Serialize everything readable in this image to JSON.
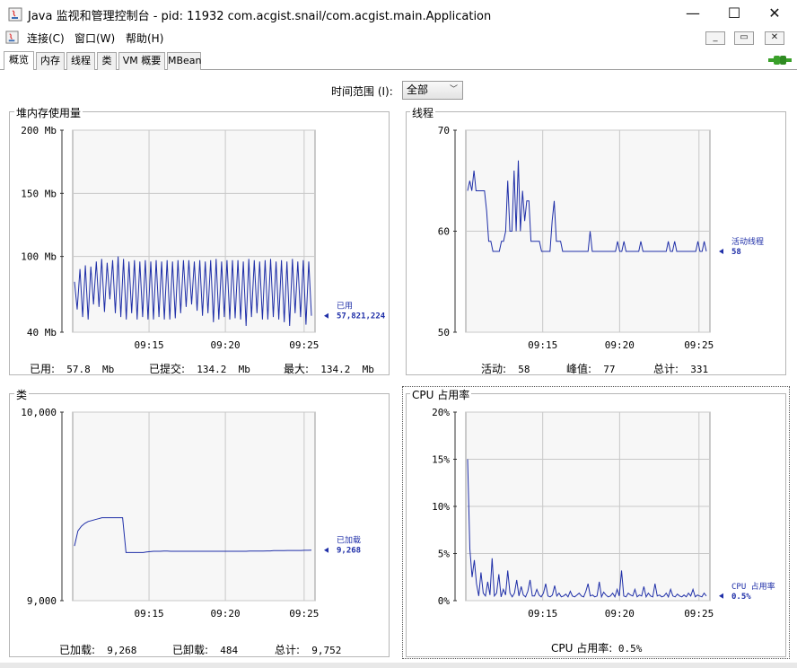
{
  "window": {
    "title": "Java 监视和管理控制台 - pid: 11932 com.acgist.snail/com.acgist.main.Application",
    "minimize": "—",
    "maximize": "☐",
    "close": "✕"
  },
  "menu": {
    "items": [
      "连接(C)",
      "窗口(W)",
      "帮助(H)"
    ]
  },
  "tabs": [
    "概览",
    "内存",
    "线程",
    "类",
    "VM 概要",
    "MBean"
  ],
  "time_range": {
    "label": "时间范围 (I):",
    "value": "全部"
  },
  "x_ticks": [
    "09:15",
    "09:20",
    "09:25"
  ],
  "chart_data": [
    {
      "type": "line",
      "title": "堆内存使用量",
      "y_ticks": [
        "200 Mb",
        "150 Mb",
        "100 Mb",
        "40 Mb"
      ],
      "ylim": [
        40,
        200
      ],
      "x_ticks": [
        "09:15",
        "09:20",
        "09:25"
      ],
      "series": [
        {
          "name": "已用",
          "last_value": "57,821,224",
          "values": [
            80,
            58,
            90,
            52,
            93,
            50,
            92,
            62,
            96,
            60,
            98,
            56,
            95,
            66,
            97,
            55,
            100,
            52,
            98,
            50,
            96,
            55,
            97,
            50,
            96,
            52,
            97,
            50,
            96,
            50,
            97,
            52,
            96,
            50,
            97,
            50,
            96,
            51,
            97,
            55,
            97,
            60,
            97,
            62,
            96,
            57,
            97,
            53,
            96,
            55,
            97,
            48,
            98,
            50,
            96,
            52,
            97,
            50,
            97,
            51,
            97,
            50,
            96,
            45,
            98,
            52,
            97,
            55,
            96,
            50,
            97,
            50,
            98,
            52,
            96,
            50,
            97,
            48,
            96,
            45,
            98,
            55,
            96,
            52,
            97,
            46,
            96,
            53
          ]
        }
      ],
      "footer": {
        "used_label": "已用:",
        "used": "57.8  Mb",
        "committed_label": "已提交:",
        "committed": "134.2  Mb",
        "max_label": "最大:",
        "max": "134.2  Mb"
      }
    },
    {
      "type": "line",
      "title": "线程",
      "y_ticks": [
        "70",
        "60",
        "50"
      ],
      "ylim": [
        50,
        70
      ],
      "x_ticks": [
        "09:15",
        "09:20",
        "09:25"
      ],
      "series": [
        {
          "name": "活动线程",
          "last_value": "58",
          "values": [
            64,
            65,
            64,
            66,
            64,
            64,
            64,
            64,
            64,
            62,
            59,
            59,
            58,
            58,
            58,
            58,
            59,
            59,
            60,
            65,
            60,
            60,
            66,
            60,
            67,
            60,
            64,
            61,
            63,
            63,
            59,
            59,
            59,
            59,
            59,
            58,
            58,
            58,
            58,
            58,
            61,
            63,
            59,
            59,
            59,
            58,
            58,
            58,
            58,
            58,
            58,
            58,
            58,
            58,
            58,
            58,
            58,
            58,
            60,
            58,
            58,
            58,
            58,
            58,
            58,
            58,
            58,
            58,
            58,
            58,
            58,
            59,
            58,
            58,
            59,
            58,
            58,
            58,
            58,
            58,
            58,
            58,
            59,
            58,
            58,
            58,
            58,
            58,
            58,
            58,
            58,
            58,
            58,
            58,
            58,
            59,
            58,
            58,
            59,
            58,
            58,
            58,
            58,
            58,
            58,
            58,
            58,
            58,
            58,
            59,
            58,
            58,
            59,
            58
          ]
        }
      ],
      "footer": {
        "active_label": "活动:",
        "active": "58",
        "peak_label": "峰值:",
        "peak": "77",
        "total_label": "总计:",
        "total": "331"
      }
    },
    {
      "type": "line",
      "title": "类",
      "y_ticks": [
        "10,000",
        "9,000"
      ],
      "ylim": [
        9000,
        10000
      ],
      "x_ticks": [
        "09:15",
        "09:20",
        "09:25"
      ],
      "series": [
        {
          "name": "已加载",
          "last_value": "9,268",
          "values": [
            9290,
            9370,
            9395,
            9410,
            9420,
            9425,
            9430,
            9435,
            9440,
            9440,
            9440,
            9440,
            9440,
            9440,
            9440,
            9255,
            9255,
            9255,
            9255,
            9255,
            9255,
            9258,
            9260,
            9262,
            9262,
            9262,
            9263,
            9263,
            9262,
            9262,
            9262,
            9262,
            9262,
            9262,
            9262,
            9262,
            9262,
            9262,
            9262,
            9262,
            9262,
            9262,
            9262,
            9262,
            9262,
            9262,
            9262,
            9262,
            9262,
            9262,
            9262,
            9263,
            9263,
            9263,
            9263,
            9263,
            9264,
            9264,
            9265,
            9265,
            9265,
            9265,
            9266,
            9266,
            9266,
            9266,
            9266,
            9267,
            9267,
            9268
          ]
        }
      ],
      "footer": {
        "loaded_label": "已加载:",
        "loaded": "9,268",
        "unloaded_label": "已卸载:",
        "unloaded": "484",
        "total_label": "总计:",
        "total": "9,752"
      }
    },
    {
      "type": "line",
      "title": "CPU 占用率",
      "y_ticks": [
        "20%",
        "15%",
        "10%",
        "5%",
        "0%"
      ],
      "ylim": [
        0,
        20
      ],
      "x_ticks": [
        "09:15",
        "09:20",
        "09:25"
      ],
      "series": [
        {
          "name": "CPU 占用率",
          "last_value": "0.5%",
          "values": [
            15,
            5.5,
            2.5,
            4.3,
            1.8,
            0.5,
            3.0,
            0.8,
            0.5,
            2.0,
            0.6,
            4.5,
            0.5,
            0.8,
            2.8,
            0.4,
            1.2,
            0.6,
            3.2,
            0.8,
            0.4,
            0.8,
            2.2,
            0.5,
            1.5,
            0.6,
            0.4,
            1.0,
            2.2,
            0.5,
            0.5,
            1.2,
            0.6,
            0.4,
            0.8,
            1.8,
            0.5,
            0.4,
            0.6,
            1.6,
            0.5,
            0.8,
            0.4,
            0.5,
            0.7,
            0.4,
            1.0,
            0.5,
            0.4,
            0.6,
            0.8,
            0.5,
            0.4,
            1.0,
            1.8,
            0.5,
            0.6,
            0.4,
            0.5,
            2.0,
            0.4,
            0.9,
            0.6,
            0.4,
            0.5,
            0.8,
            0.4,
            1.2,
            0.5,
            3.2,
            0.5,
            0.4,
            0.8,
            0.6,
            0.5,
            1.2,
            0.4,
            0.6,
            0.5,
            1.5,
            0.4,
            0.8,
            0.5,
            0.4,
            1.8,
            0.5,
            0.6,
            0.4,
            0.5,
            0.8,
            0.4,
            1.2,
            0.5,
            0.4,
            0.7,
            0.5,
            0.4,
            0.6,
            0.4,
            0.8,
            0.5,
            1.2,
            0.4,
            0.6,
            0.5,
            0.4,
            0.8,
            0.5
          ]
        }
      ],
      "footer": {
        "label": "CPU 占用率:",
        "value": "0.5%"
      }
    }
  ],
  "colors": {
    "series": "#1f2fa8",
    "grid": "#c8c8c8",
    "plot_bg": "#f7f7f7",
    "tab_icon_green": "#3aa02a"
  }
}
